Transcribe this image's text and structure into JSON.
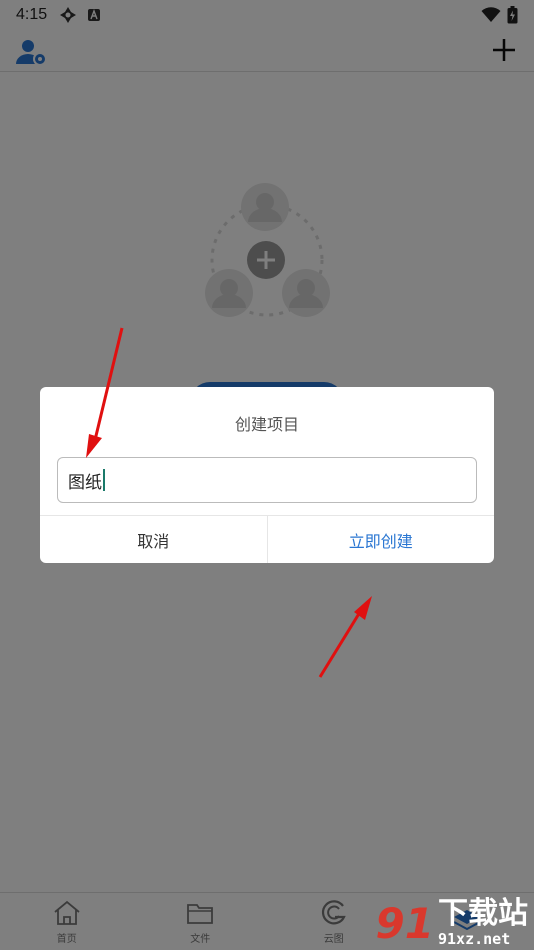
{
  "status_bar": {
    "time": "4:15"
  },
  "dialog": {
    "title": "创建项目",
    "input_value": "图纸",
    "cancel_label": "取消",
    "confirm_label": "立即创建"
  },
  "tabbar": {
    "items": [
      {
        "label": "首页",
        "icon": "home-icon"
      },
      {
        "label": "文件",
        "icon": "folder-icon"
      },
      {
        "label": "云图",
        "icon": "cloud-g-icon"
      },
      {
        "label": "",
        "icon": "layers-icon"
      }
    ]
  },
  "watermark": {
    "logo": "91",
    "cn": "下载站",
    "en": "91xz.net"
  },
  "colors": {
    "accent": "#2a76d2",
    "annotation_arrow": "#e01010",
    "watermark_red": "#d9382d"
  }
}
